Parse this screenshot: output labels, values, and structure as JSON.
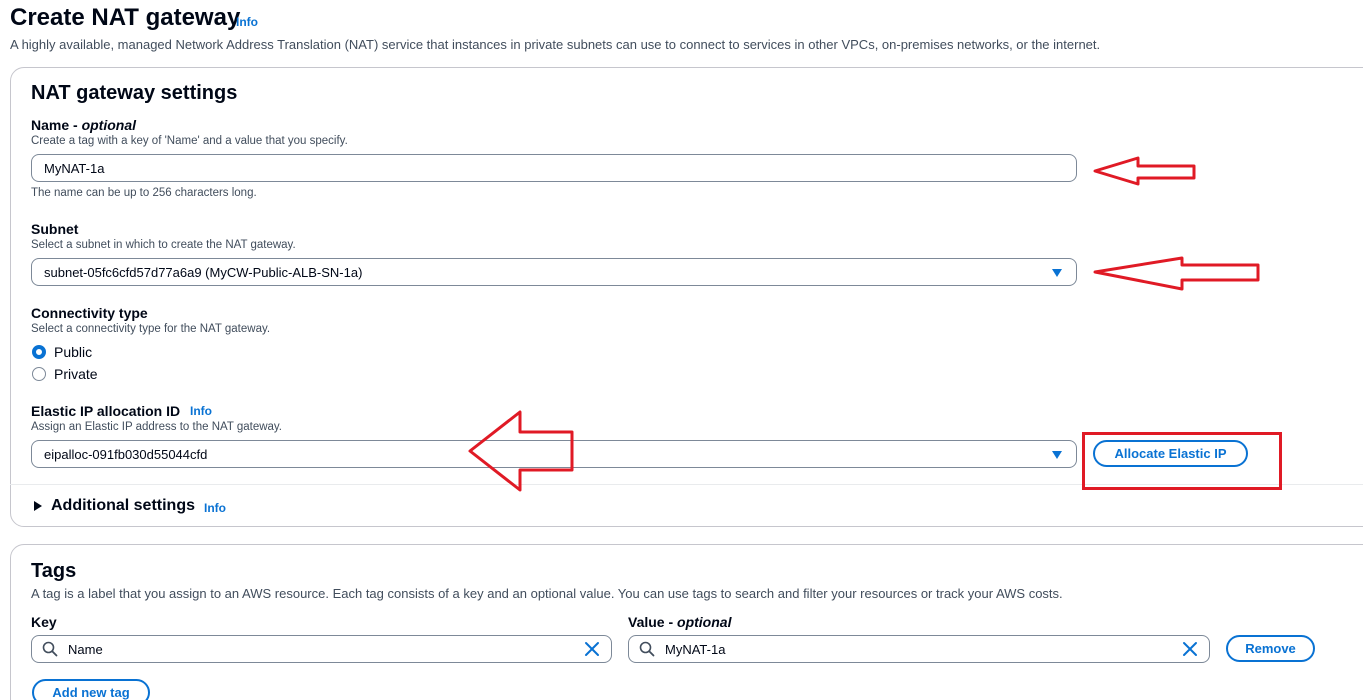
{
  "header": {
    "title": "Create NAT gateway",
    "info": "Info",
    "description": "A highly available, managed Network Address Translation (NAT) service that instances in private subnets can use to connect to services in other VPCs, on-premises networks, or the internet."
  },
  "settings": {
    "title": "NAT gateway settings",
    "name": {
      "label": "Name - ",
      "label_optional": "optional",
      "description": "Create a tag with a key of 'Name' and a value that you specify.",
      "value": "MyNAT-1a",
      "constraint": "The name can be up to 256 characters long."
    },
    "subnet": {
      "label": "Subnet",
      "description": "Select a subnet in which to create the NAT gateway.",
      "value": "subnet-05fc6cfd57d77a6a9 (MyCW-Public-ALB-SN-1a)"
    },
    "connectivity": {
      "label": "Connectivity type",
      "description": "Select a connectivity type for the NAT gateway.",
      "options": [
        "Public",
        "Private"
      ],
      "selected": "Public"
    },
    "eip": {
      "label": "Elastic IP allocation ID",
      "info": "Info",
      "description": "Assign an Elastic IP address to the NAT gateway.",
      "value": "eipalloc-091fb030d55044cfd",
      "allocate_button": "Allocate Elastic IP"
    },
    "additional": {
      "label": "Additional settings",
      "info": "Info"
    }
  },
  "tags": {
    "title": "Tags",
    "description": "A tag is a label that you assign to an AWS resource. Each tag consists of a key and an optional value. You can use tags to search and filter your resources or track your AWS costs.",
    "key_label": "Key",
    "value_label": "Value - ",
    "value_label_optional": "optional",
    "rows": [
      {
        "key": "Name",
        "value": "MyNAT-1a",
        "remove": "Remove"
      }
    ],
    "add_button": "Add new tag"
  },
  "colors": {
    "accent": "#0972d3",
    "annotation": "#e01a25"
  }
}
